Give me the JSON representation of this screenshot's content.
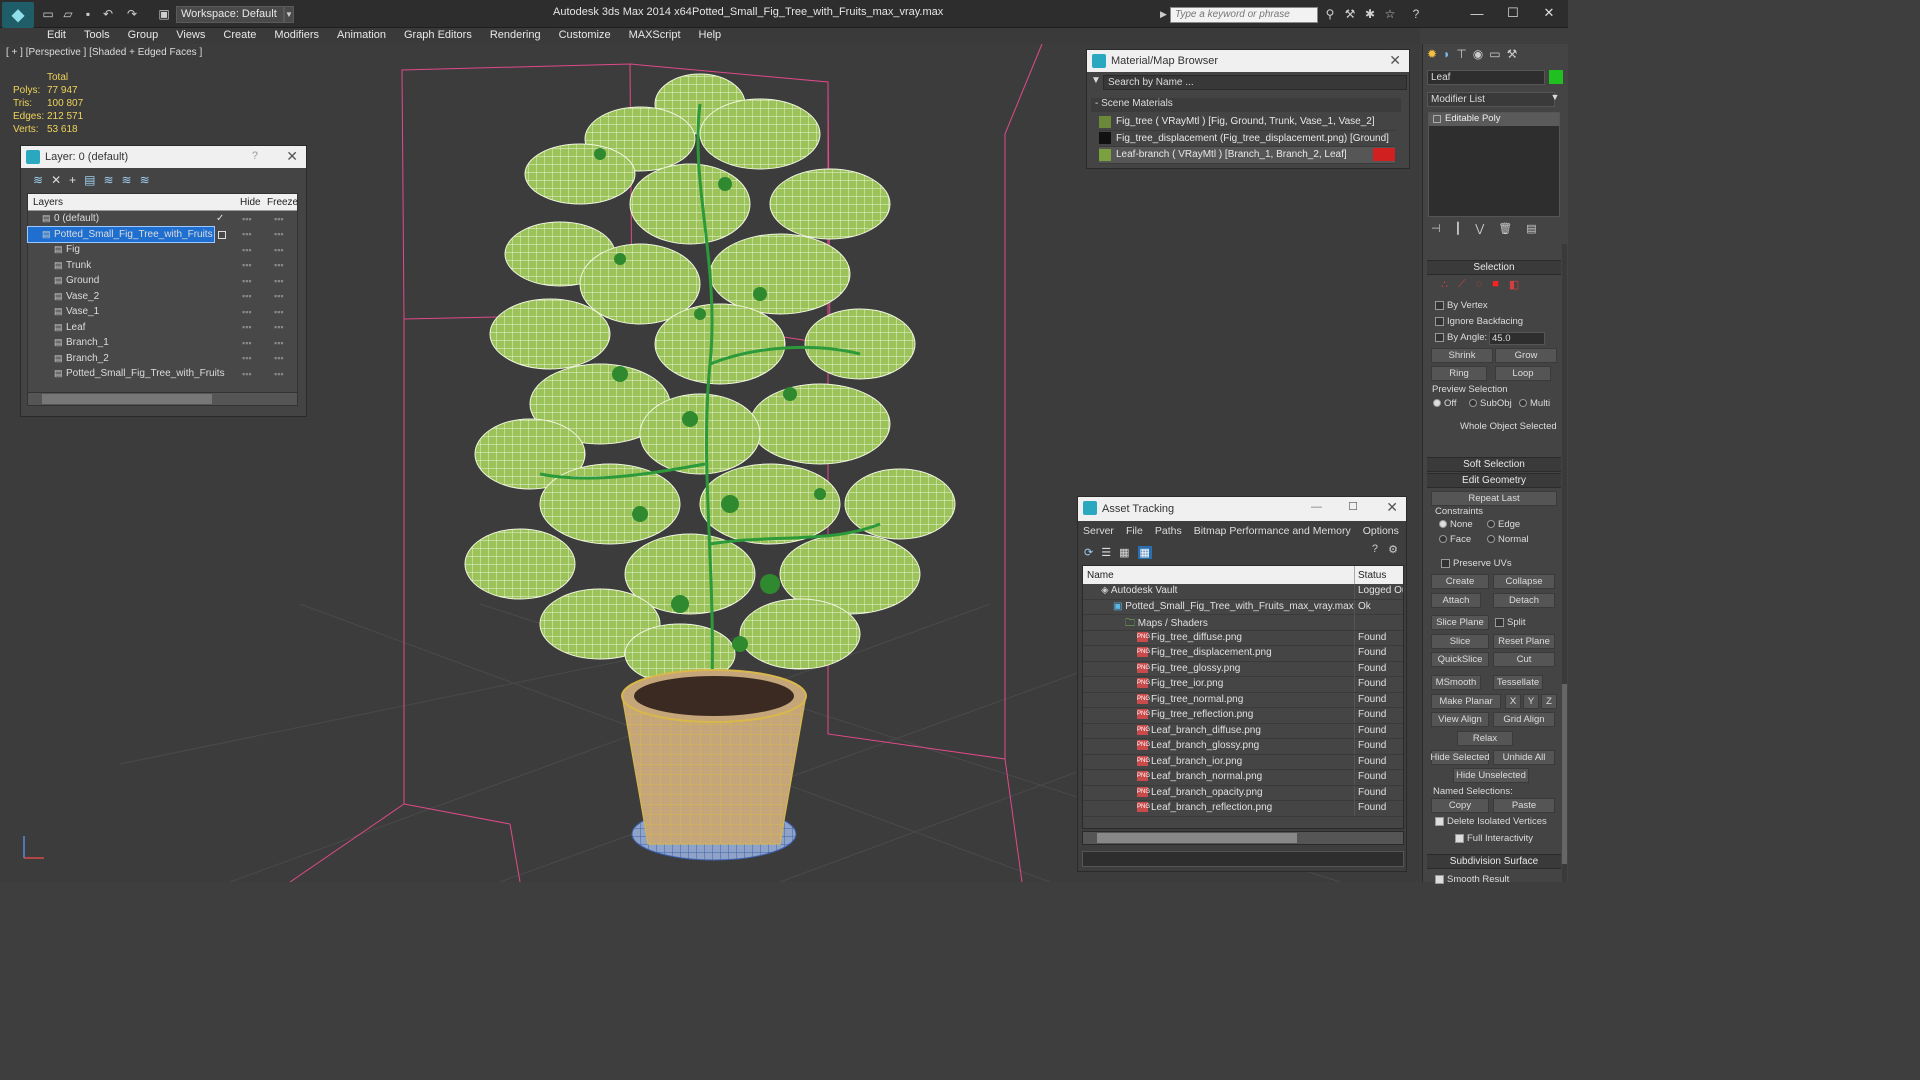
{
  "titlebar": {
    "app_title": "Autodesk 3ds Max  2014 x64",
    "file_title": "Potted_Small_Fig_Tree_with_Fruits_max_vray.max",
    "workspace": "Workspace: Default",
    "search_placeholder": "Type a keyword or phrase"
  },
  "menu": [
    "Edit",
    "Tools",
    "Group",
    "Views",
    "Create",
    "Modifiers",
    "Animation",
    "Graph Editors",
    "Rendering",
    "Customize",
    "MAXScript",
    "Help"
  ],
  "viewport": {
    "label": "[ + ] [Perspective ] [Shaded + Edged Faces ]",
    "stats": {
      "header": "Total",
      "rows": [
        [
          "Polys:",
          "77 947"
        ],
        [
          "Tris:",
          "100 807"
        ],
        [
          "Edges:",
          "212 571"
        ],
        [
          "Verts:",
          "53 618"
        ]
      ]
    }
  },
  "layer_panel": {
    "title": "Layer: 0 (default)",
    "help": "?",
    "col_layers": "Layers",
    "col_hide": "Hide",
    "col_freeze": "Freeze",
    "rows": [
      {
        "name": "0 (default)",
        "indent": 1
      },
      {
        "name": "Potted_Small_Fig_Tree_with_Fruits",
        "indent": 1,
        "selected": true
      },
      {
        "name": "Fig",
        "indent": 2
      },
      {
        "name": "Trunk",
        "indent": 2
      },
      {
        "name": "Ground",
        "indent": 2
      },
      {
        "name": "Vase_2",
        "indent": 2
      },
      {
        "name": "Vase_1",
        "indent": 2
      },
      {
        "name": "Leaf",
        "indent": 2
      },
      {
        "name": "Branch_1",
        "indent": 2
      },
      {
        "name": "Branch_2",
        "indent": 2
      },
      {
        "name": "Potted_Small_Fig_Tree_with_Fruits",
        "indent": 2
      }
    ]
  },
  "material_browser": {
    "title": "Material/Map Browser",
    "search": "Search by Name ...",
    "section": "- Scene Materials",
    "items": [
      "Fig_tree  ( VRayMtl ) [Fig, Ground, Trunk, Vase_1, Vase_2]",
      "Fig_tree_displacement (Fig_tree_displacement.png) [Ground]",
      "Leaf-branch  ( VRayMtl ) [Branch_1, Branch_2, Leaf]"
    ]
  },
  "asset_tracking": {
    "title": "Asset Tracking",
    "menu": [
      "Server",
      "File",
      "Paths",
      "Bitmap Performance and Memory",
      "Options"
    ],
    "col_name": "Name",
    "col_status": "Status",
    "rows": [
      {
        "name": "Autodesk Vault",
        "status": "Logged Ou",
        "indent": 0
      },
      {
        "name": "Potted_Small_Fig_Tree_with_Fruits_max_vray.max",
        "status": "Ok",
        "indent": 1
      },
      {
        "name": "Maps / Shaders",
        "status": "",
        "indent": 2
      },
      {
        "name": "Fig_tree_diffuse.png",
        "status": "Found",
        "indent": 3
      },
      {
        "name": "Fig_tree_displacement.png",
        "status": "Found",
        "indent": 3
      },
      {
        "name": "Fig_tree_glossy.png",
        "status": "Found",
        "indent": 3
      },
      {
        "name": "Fig_tree_ior.png",
        "status": "Found",
        "indent": 3
      },
      {
        "name": "Fig_tree_normal.png",
        "status": "Found",
        "indent": 3
      },
      {
        "name": "Fig_tree_reflection.png",
        "status": "Found",
        "indent": 3
      },
      {
        "name": "Leaf_branch_diffuse.png",
        "status": "Found",
        "indent": 3
      },
      {
        "name": "Leaf_branch_glossy.png",
        "status": "Found",
        "indent": 3
      },
      {
        "name": "Leaf_branch_ior.png",
        "status": "Found",
        "indent": 3
      },
      {
        "name": "Leaf_branch_normal.png",
        "status": "Found",
        "indent": 3
      },
      {
        "name": "Leaf_branch_opacity.png",
        "status": "Found",
        "indent": 3
      },
      {
        "name": "Leaf_branch_reflection.png",
        "status": "Found",
        "indent": 3
      }
    ]
  },
  "command_panel": {
    "object_name": "Leaf",
    "modifier_list": "Modifier List",
    "stack_item": "Editable Poly",
    "selection": {
      "header": "Selection",
      "by_vertex": "By Vertex",
      "ignore_backfacing": "Ignore Backfacing",
      "by_angle": "By Angle:",
      "angle_value": "45.0",
      "shrink": "Shrink",
      "grow": "Grow",
      "ring": "Ring",
      "loop": "Loop",
      "preview_selection": "Preview Selection",
      "off": "Off",
      "subobj": "SubObj",
      "multi": "Multi",
      "whole_object": "Whole Object Selected"
    },
    "soft_selection": "Soft Selection",
    "edit_geometry": {
      "header": "Edit Geometry",
      "repeat_last": "Repeat Last",
      "constraints": "Constraints",
      "none": "None",
      "edge": "Edge",
      "face": "Face",
      "normal": "Normal",
      "preserve_uvs": "Preserve UVs",
      "create": "Create",
      "collapse": "Collapse",
      "attach": "Attach",
      "detach": "Detach",
      "slice_plane": "Slice Plane",
      "split": "Split",
      "slice": "Slice",
      "reset_plane": "Reset Plane",
      "quickslice": "QuickSlice",
      "cut": "Cut",
      "msmooth": "MSmooth",
      "tessellate": "Tessellate",
      "make_planar": "Make Planar",
      "x": "X",
      "y": "Y",
      "z": "Z",
      "view_align": "View Align",
      "grid_align": "Grid Align",
      "relax": "Relax",
      "hide_selected": "Hide Selected",
      "unhide_all": "Unhide All",
      "hide_unselected": "Hide Unselected",
      "named_selections": "Named Selections:",
      "copy": "Copy",
      "paste": "Paste",
      "delete_isolated": "Delete Isolated Vertices",
      "full_interactivity": "Full Interactivity"
    },
    "subdivision_surface": "Subdivision Surface",
    "smooth_result": "Smooth Result"
  },
  "colors": {
    "accent": "#2aa8bf",
    "selection": "#1f6fd0",
    "stats": "#f0d35a",
    "leaf": "#a4c860",
    "vase": "#c2a070"
  }
}
